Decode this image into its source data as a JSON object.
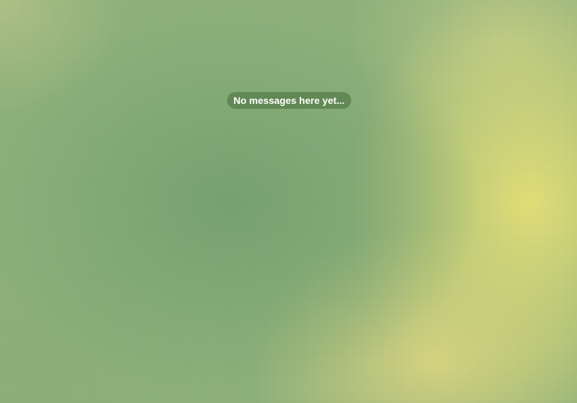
{
  "chat": {
    "empty_state_text": "No messages here yet..."
  },
  "theme": {
    "background_green": "#76a270",
    "background_yellow": "#e8e278",
    "bubble_color": "#547c48",
    "text_color": "#ffffff"
  }
}
